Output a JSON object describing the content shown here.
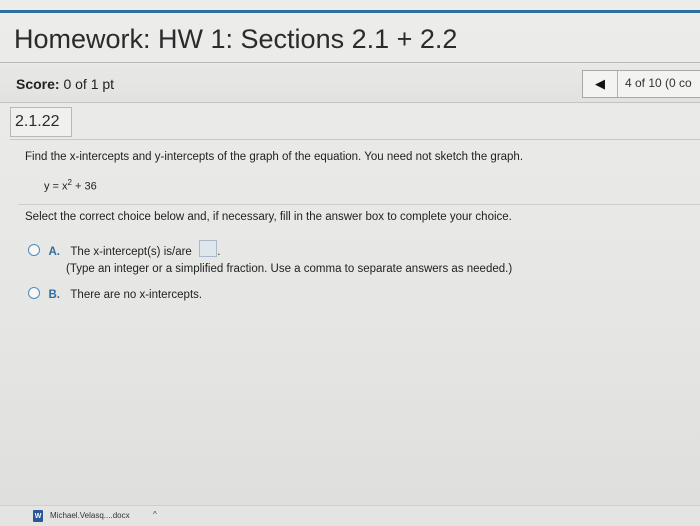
{
  "header": {
    "title": "Homework: HW 1: Sections 2.1 + 2.2"
  },
  "score_bar": {
    "score_label": "Score:",
    "score_value": "0 of 1 pt",
    "prev_icon": "left-triangle-icon",
    "question_count": "4 of 10 (0 co"
  },
  "question": {
    "number": "2.1.22",
    "instructions": "Find the x-intercepts and y-intercepts of the graph of the equation. You need not sketch the graph.",
    "equation_prefix": "y = x",
    "equation_exponent": "2",
    "equation_suffix": " + 36",
    "select_instruction": "Select the correct choice below and, if necessary, fill in the answer box to complete your choice.",
    "choices": [
      {
        "letter": "A.",
        "text": "The x-intercept(s) is/are",
        "hint": "(Type an integer or a simplified fraction. Use a comma to separate answers as needed.)",
        "answer_value": ""
      },
      {
        "letter": "B.",
        "text": "There are no x-intercepts."
      }
    ]
  },
  "taskbar": {
    "download_name": "Michael.Velasq....docx",
    "caret": "^"
  },
  "colors": {
    "accent": "#2f6f9f",
    "choice_letter": "#2e6ea3"
  }
}
